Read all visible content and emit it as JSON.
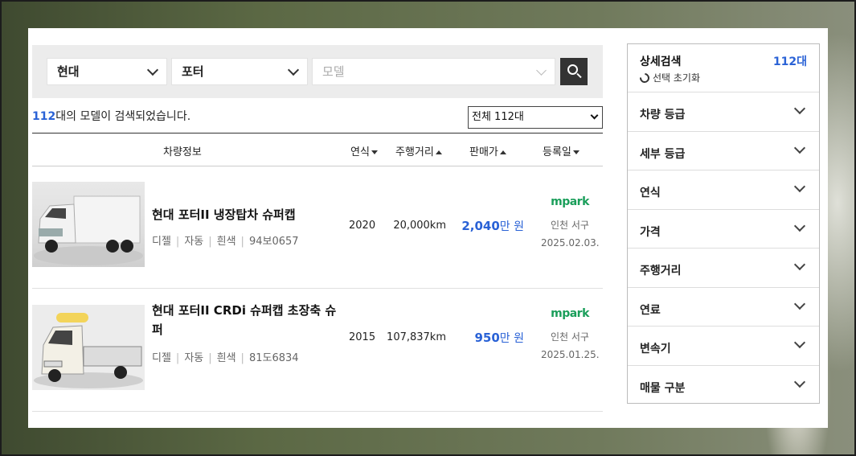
{
  "search": {
    "maker": "현대",
    "model": "포터",
    "submodel_placeholder": "모델"
  },
  "results": {
    "count": "112",
    "text": "대의 모델이 검색되었습니다.",
    "total_option": "전체 112대"
  },
  "table": {
    "headers": {
      "info": "차량정보",
      "year": "연식",
      "mileage": "주행거리",
      "price": "판매가",
      "registered": "등록일"
    },
    "rows": [
      {
        "title": "현대 포터II 냉장탑차 슈퍼캡",
        "fuel": "디젤",
        "transmission": "자동",
        "color": "흰색",
        "plate": "94보0657",
        "year": "2020",
        "mileage": "20,000km",
        "price_num": "2,040",
        "price_unit": "만 원",
        "dealer_logo": "mpark",
        "location": "인천 서구",
        "date": "2025.02.03."
      },
      {
        "title": "현대 포터II CRDi 슈퍼캡 초장축 슈퍼",
        "fuel": "디젤",
        "transmission": "자동",
        "color": "흰색",
        "plate": "81도6834",
        "year": "2015",
        "mileage": "107,837km",
        "price_num": "950",
        "price_unit": "만 원",
        "dealer_logo": "mpark",
        "location": "인천 서구",
        "date": "2025.01.25."
      }
    ]
  },
  "sidebar": {
    "title": "상세검색",
    "count": "112대",
    "reset": "선택 초기화",
    "items": [
      "차량 등급",
      "세부 등급",
      "연식",
      "가격",
      "주행거리",
      "연료",
      "변속기",
      "매물 구분"
    ]
  },
  "colors": {
    "accent": "#2a62d6",
    "dealer": "#1a9e5a"
  }
}
